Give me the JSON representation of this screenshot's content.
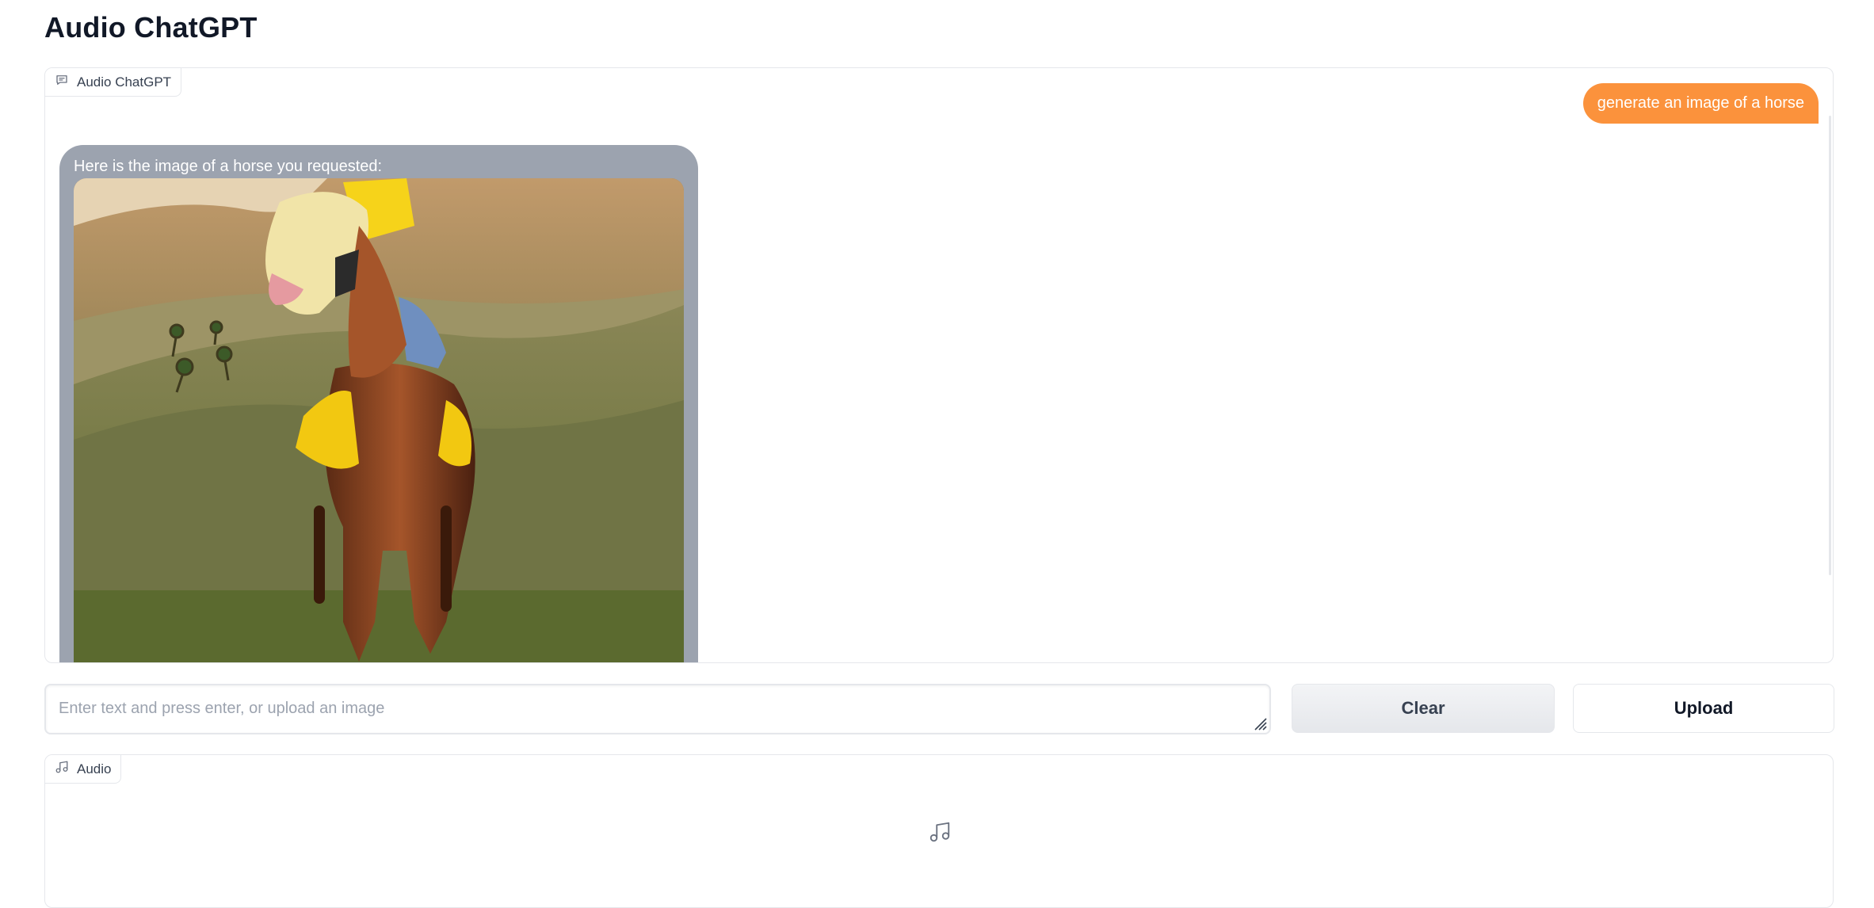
{
  "app": {
    "title": "Audio ChatGPT"
  },
  "chat": {
    "label": "Audio ChatGPT",
    "label_icon": "chat-icon",
    "messages": [
      {
        "role": "user",
        "text": "generate an image of a horse"
      },
      {
        "role": "bot",
        "text": "Here is the image of a horse you requested:",
        "image": "generated-horse-image"
      }
    ]
  },
  "input": {
    "value": "",
    "placeholder": "Enter text and press enter, or upload an image"
  },
  "buttons": {
    "clear": "Clear",
    "upload": "Upload"
  },
  "audio": {
    "label": "Audio",
    "label_icon": "music-icon",
    "empty_icon": "music-icon"
  },
  "colors": {
    "user_bubble": "#fb923c",
    "bot_bubble": "#9ca3af",
    "border": "#e5e7eb"
  }
}
